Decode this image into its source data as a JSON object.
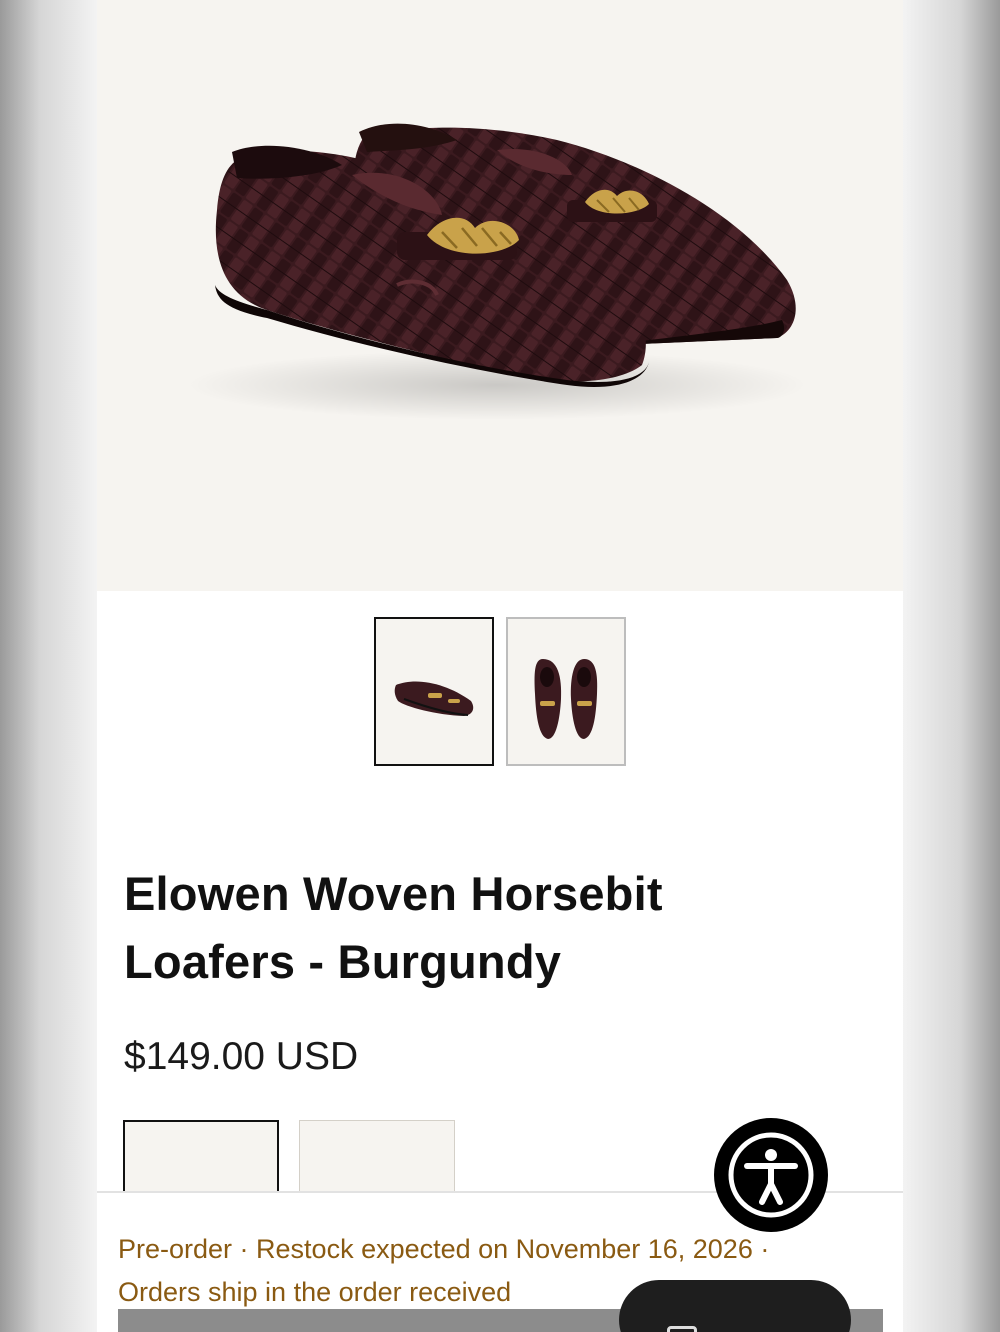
{
  "product": {
    "title": "Elowen Woven Horsebit Loafers - Burgundy",
    "price": "$149.00 USD",
    "notice": "Pre-order · Restock expected on November 16, 2026 · Orders ship in the order received",
    "image_alt": "Elowen Woven Horsebit Loafers - Burgundy"
  },
  "gallery": {
    "thumbnails": [
      {
        "view": "side pair",
        "selected": true
      },
      {
        "view": "top pair",
        "selected": false
      }
    ]
  },
  "swatches": [
    {
      "selected": true
    },
    {
      "selected": false
    }
  ],
  "colors": {
    "leather": "#3b1a1f",
    "hardware": "#c9a24a",
    "image_bg": "#f6f4f0",
    "notice_text": "#8a5a12"
  },
  "icons": {
    "accessibility": "accessibility-icon",
    "chat": "chat-icon"
  }
}
